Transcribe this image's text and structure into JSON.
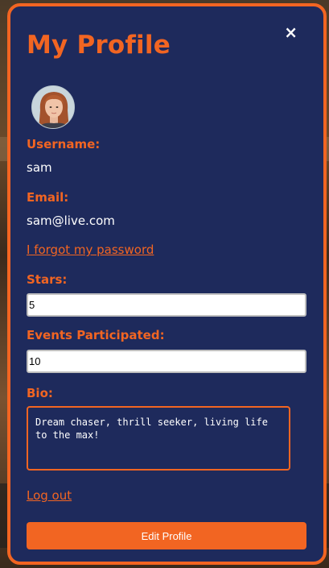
{
  "modal": {
    "title": "My Profile",
    "close_label": "×"
  },
  "profile": {
    "username_label": "Username:",
    "username": "sam",
    "email_label": "Email:",
    "email": "sam@live.com",
    "forgot_password": "I forgot my password",
    "stars_label": "Stars:",
    "stars": "5",
    "events_label": "Events Participated:",
    "events": "10",
    "bio_label": "Bio:",
    "bio": "Dream chaser, thrill seeker, living life to the max!",
    "logout": "Log out",
    "edit_button": "Edit Profile"
  },
  "colors": {
    "accent": "#f26522",
    "panel": "#1e2a5c"
  }
}
